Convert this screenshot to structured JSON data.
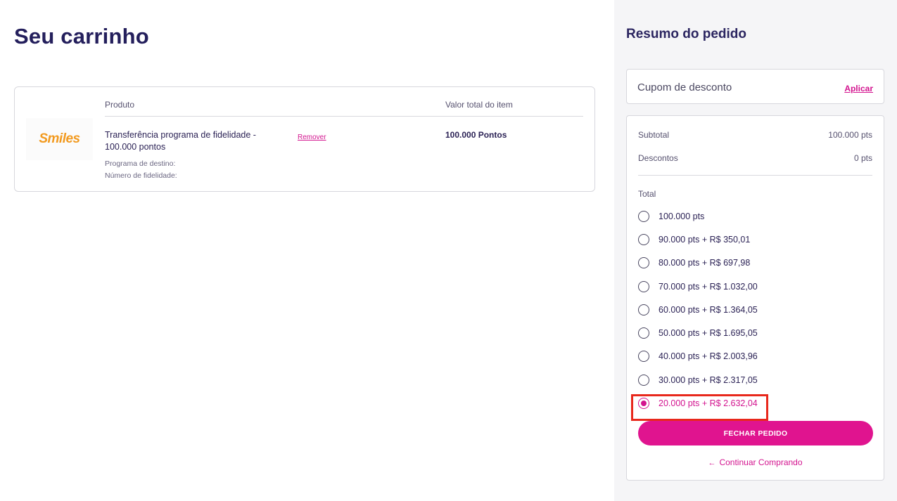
{
  "cart": {
    "title": "Seu carrinho",
    "columns": {
      "product": "Produto",
      "total": "Valor total do item"
    },
    "item": {
      "logo_text": "Smiles",
      "name": "Transferência programa de fidelidade - 100.000 pontos",
      "destination_label": "Programa de destino:",
      "loyalty_number_label": "Número de fidelidade:",
      "remove_label": "Remover",
      "total": "100.000 Pontos"
    }
  },
  "summary": {
    "title": "Resumo do pedido",
    "coupon": {
      "label": "Cupom de desconto",
      "apply_label": "Aplicar"
    },
    "subtotal_label": "Subtotal",
    "subtotal_value": "100.000 pts",
    "discounts_label": "Descontos",
    "discounts_value": "0 pts",
    "total_label": "Total",
    "payment_options": [
      {
        "label": "100.000 pts",
        "selected": false
      },
      {
        "label": "90.000 pts + R$ 350,01",
        "selected": false
      },
      {
        "label": "80.000 pts + R$ 697,98",
        "selected": false
      },
      {
        "label": "70.000 pts + R$ 1.032,00",
        "selected": false
      },
      {
        "label": "60.000 pts + R$ 1.364,05",
        "selected": false
      },
      {
        "label": "50.000 pts + R$ 1.695,05",
        "selected": false
      },
      {
        "label": "40.000 pts + R$ 2.003,96",
        "selected": false
      },
      {
        "label": "30.000 pts + R$ 2.317,05",
        "selected": false
      },
      {
        "label": "20.000 pts + R$ 2.632,04",
        "selected": true
      }
    ],
    "checkout_label": "FECHAR PEDIDO",
    "continue_label": "Continuar Comprando"
  },
  "colors": {
    "accent": "#e0148f",
    "title": "#241f5c",
    "highlight": "#e8281c"
  }
}
